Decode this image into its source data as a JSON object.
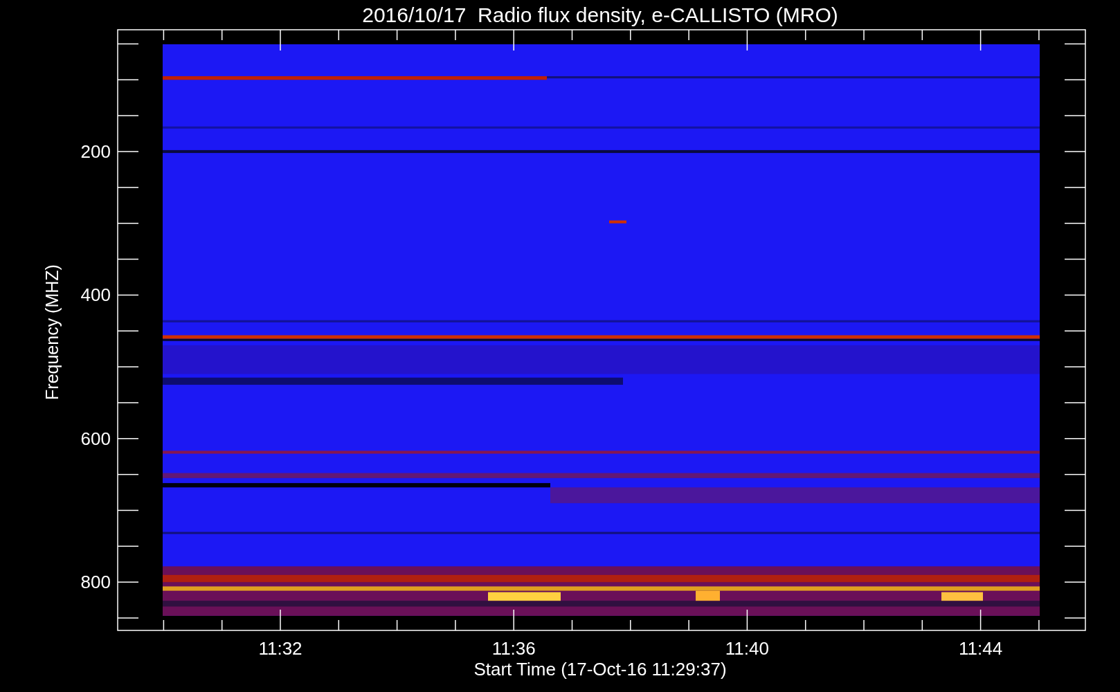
{
  "title": "2016/10/17  Radio flux density, e-CALLISTO (MRO)",
  "y_axis": {
    "label": "Frequency (MHZ)",
    "ticks": [
      "200",
      "400",
      "600",
      "800"
    ]
  },
  "x_axis": {
    "label": "Start Time (17-Oct-16 11:29:37)",
    "ticks": [
      "11:32",
      "11:36",
      "11:40",
      "11:44"
    ]
  }
}
